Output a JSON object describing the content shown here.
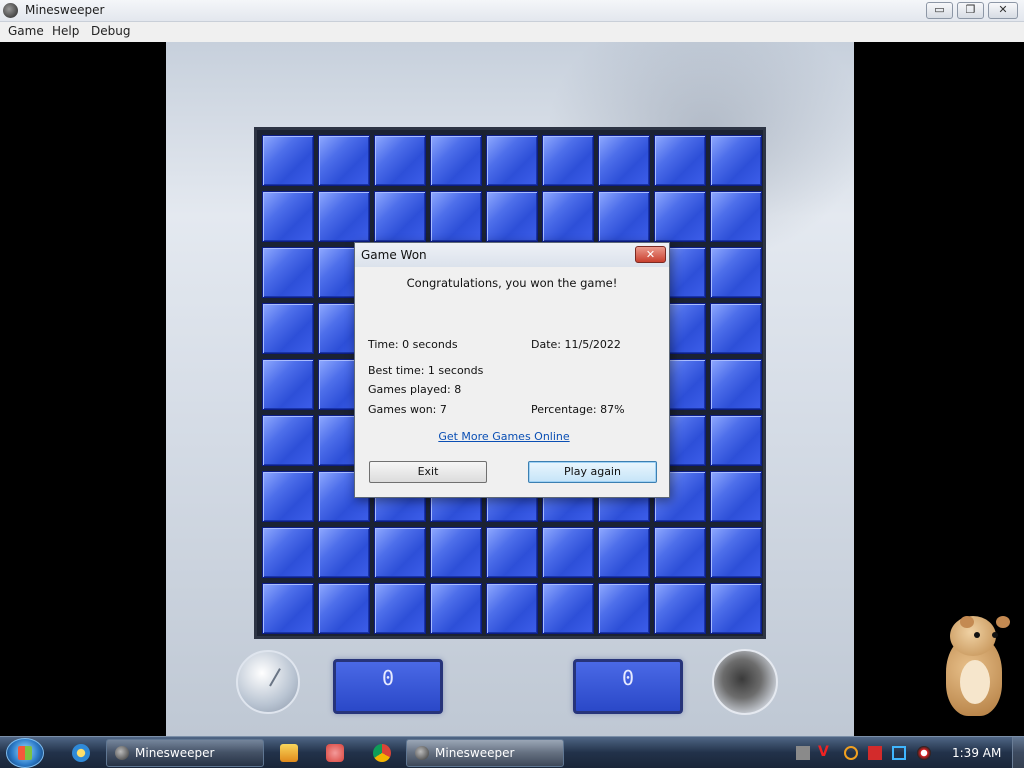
{
  "window": {
    "title": "Minesweeper",
    "minimize_symbol": "▭",
    "maximize_symbol": "❐",
    "close_symbol": "✕"
  },
  "menu": {
    "items": [
      "Game",
      "Help",
      "Debug"
    ]
  },
  "game": {
    "time_display": "0",
    "mines_display": "0"
  },
  "dialog": {
    "title": "Game Won",
    "close_symbol": "✕",
    "message": "Congratulations, you won the game!",
    "time": "Time: 0 seconds",
    "date": "Date: 11/5/2022",
    "best_time": "Best time: 1 seconds",
    "games_played": "Games played: 8",
    "games_won": "Games won: 7",
    "percentage": "Percentage: 87%",
    "link": "Get More Games Online",
    "exit_label": "Exit",
    "play_again_label": "Play again"
  },
  "taskbar": {
    "tasks": [
      {
        "label": "Minesweeper",
        "icon": "minesweeper-icon"
      },
      {
        "label": "Minesweeper",
        "icon": "minesweeper-icon"
      }
    ],
    "quick_launch_icons": [
      "internet-explorer-icon",
      "media-player-icon",
      "app-icon",
      "chrome-icon"
    ],
    "tray_icons": [
      "tray-app-icon",
      "v-icon",
      "search-icon",
      "flag-icon",
      "display-icon",
      "sound-icon"
    ],
    "tray_v_text": "V",
    "clock": "1:39 AM"
  },
  "colors": {
    "tile_blue": "#3d5eea",
    "link_blue": "#0a4fb4",
    "taskbar": "#22324a"
  }
}
